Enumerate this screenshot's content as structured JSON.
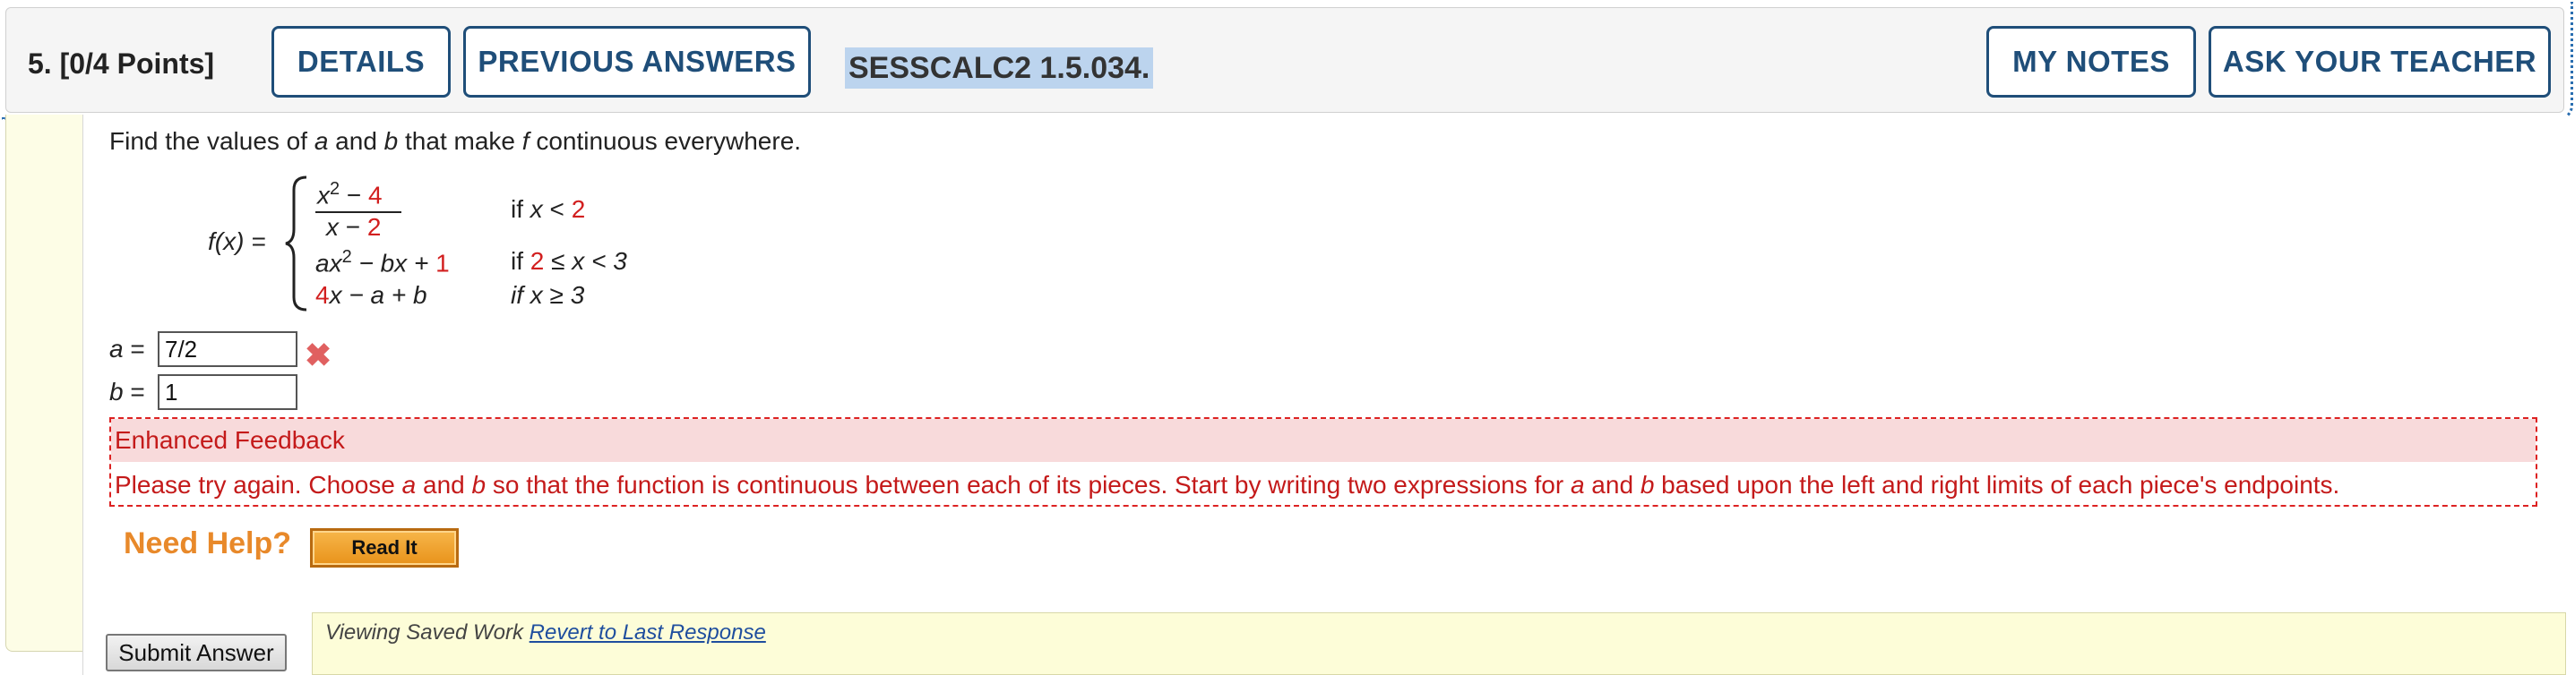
{
  "header": {
    "question_label": "5.  [0/4 Points]",
    "details_label": "DETAILS",
    "previous_answers_label": "PREVIOUS ANSWERS",
    "problem_code": "SESSCALC2 1.5.034.",
    "my_notes_label": "MY NOTES",
    "ask_teacher_label": "ASK YOUR TEACHER"
  },
  "problem": {
    "intro_1": "Find the values of ",
    "var_a": "a",
    "intro_2": " and ",
    "var_b": "b",
    "intro_3": " that make ",
    "var_f": "f",
    "intro_4": " continuous everywhere.",
    "fx_label": "f(x) =",
    "piece1": {
      "num_prefix": "x",
      "num_exp": "2",
      "num_op": " − ",
      "num_const": "4",
      "den_var": "x",
      "den_op": " − ",
      "den_const": "2",
      "cond_prefix": "if ",
      "cond_var": "x",
      "cond_op": " < ",
      "cond_val": "2"
    },
    "piece2": {
      "expr_a": "ax",
      "expr_exp": "2",
      "expr_mid": " − bx + ",
      "expr_const": "1",
      "cond_prefix": "if ",
      "cond_val": "2",
      "cond_rest": " ≤ x < 3"
    },
    "piece3": {
      "expr_coef": "4",
      "expr_rest": "x − a + b",
      "cond": "if x ≥ 3"
    }
  },
  "answers": {
    "a_label": "a",
    "b_label": "b",
    "equals": " =",
    "a_value": "7/2",
    "b_value": "1",
    "a_status": "incorrect"
  },
  "feedback": {
    "title": "Enhanced Feedback",
    "text_1": "Please try again. Choose ",
    "text_a": "a",
    "text_2": " and ",
    "text_b": "b",
    "text_3": " so that the function is continuous between each of its pieces. Start by writing two expressions for ",
    "text_a2": "a",
    "text_4": " and ",
    "text_b2": "b",
    "text_5": " based upon the left and right limits of each piece's endpoints."
  },
  "help": {
    "need_help_label": "Need Help?",
    "read_it_label": "Read It"
  },
  "footer": {
    "submit_label": "Submit Answer",
    "saved_text": "Viewing Saved Work ",
    "revert_link": "Revert to Last Response"
  },
  "colors": {
    "accent": "#1f4e79",
    "error": "#d21f1f",
    "highlight": "#bcd4ee",
    "panel_bg": "#fdfde6"
  }
}
